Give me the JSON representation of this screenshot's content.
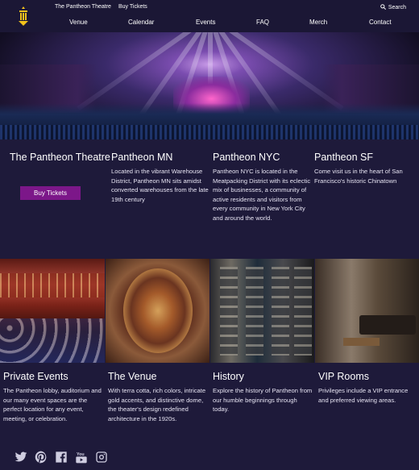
{
  "header": {
    "utility_links": [
      "The Pantheon Theatre",
      "Buy Tickets"
    ],
    "search_label": "Search",
    "nav": [
      "Venue",
      "Calendar",
      "Events",
      "FAQ",
      "Merch",
      "Contact"
    ]
  },
  "venues": [
    {
      "title": "The Pantheon Theatre",
      "text": ""
    },
    {
      "title": "Pantheon MN",
      "text": "Located in the vibrant Warehouse District, Pantheon MN sits amidst converted warehouses from the late 19th century"
    },
    {
      "title": "Pantheon NYC",
      "text": "Pantheon NYC is located in the Meatpacking District with its eclectic mix of businesses, a community of active residents and visitors from every community in New York City and around the world."
    },
    {
      "title": "Pantheon SF",
      "text": "Come visit us in the heart of San Francisco's historic Chinatown"
    }
  ],
  "buy_button": "Buy Tickets",
  "features": [
    {
      "title": "Private Events",
      "text": "The Pantheon lobby, auditorium and our many event spaces are the perfect location for any event, meeting, or celebration."
    },
    {
      "title": "The Venue",
      "text": "With terra cotta, rich colors, intricate gold accents, and distinctive dome, the theater's design redefined architecture in the 1920s."
    },
    {
      "title": "History",
      "text": "Explore the history of Pantheon from our humble beginnings through today."
    },
    {
      "title": "VIP Rooms",
      "text": "Privileges include a VIP entrance and preferred viewing areas."
    }
  ],
  "social_icons": [
    "twitter-icon",
    "pinterest-icon",
    "facebook-icon",
    "youtube-icon",
    "instagram-icon"
  ],
  "colors": {
    "background": "#1e1a3a",
    "button": "#7c1789",
    "logo": "#f2c21b"
  }
}
